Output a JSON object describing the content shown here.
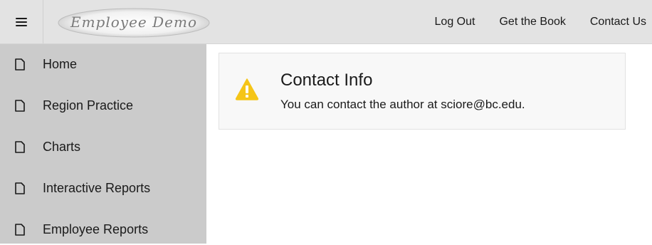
{
  "header": {
    "logo_text": "Employee Demo",
    "nav": {
      "logout": "Log Out",
      "get_book": "Get the Book",
      "contact": "Contact Us"
    }
  },
  "sidebar": {
    "items": [
      {
        "label": "Home",
        "icon": "page-icon"
      },
      {
        "label": "Region Practice",
        "icon": "page-icon"
      },
      {
        "label": "Charts",
        "icon": "page-icon"
      },
      {
        "label": "Interactive Reports",
        "icon": "page-icon"
      },
      {
        "label": "Employee Reports",
        "icon": "page-icon"
      }
    ]
  },
  "main": {
    "alert": {
      "title": "Contact Info",
      "message": "You can contact the author at sciore@bc.edu.",
      "icon": "warning-icon"
    }
  },
  "colors": {
    "header_bg": "#e3e3e3",
    "sidebar_bg": "#cbcbcb",
    "warning": "#f5c518",
    "card_bg": "#f8f8f8"
  }
}
